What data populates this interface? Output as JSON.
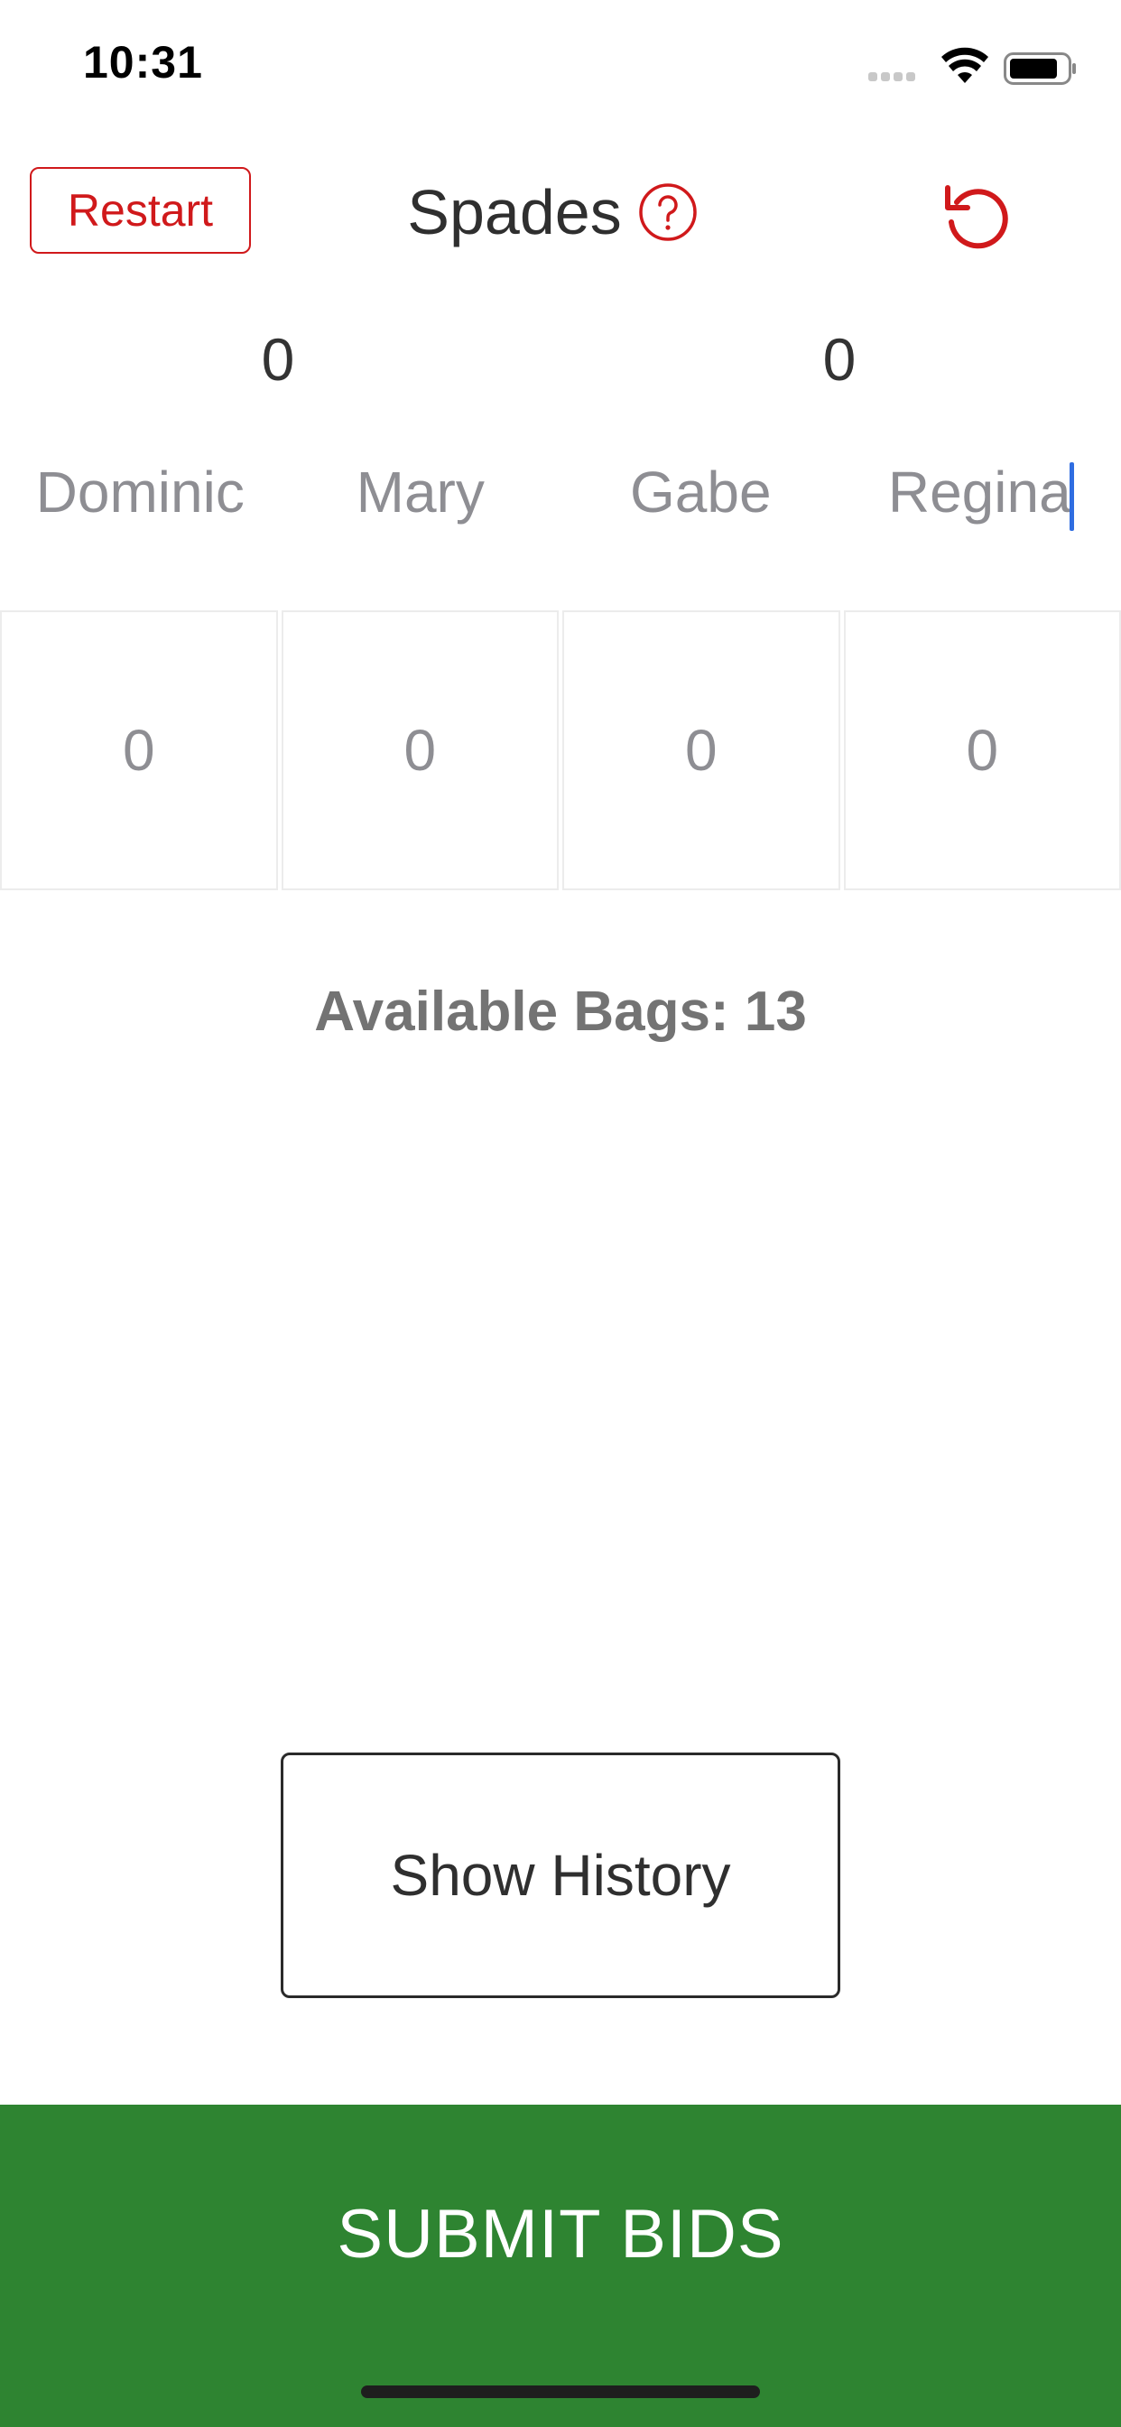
{
  "status_bar": {
    "time": "10:31",
    "icons": [
      "cellular-signal-icon",
      "wifi-icon",
      "battery-icon"
    ]
  },
  "header": {
    "restart_label": "Restart",
    "title": "Spades",
    "help_icon": "question-circle-icon",
    "undo_icon": "undo-icon"
  },
  "team_scores": [
    "0",
    "0"
  ],
  "players": [
    {
      "name": "Dominic",
      "bid": "0"
    },
    {
      "name": "Mary",
      "bid": "0"
    },
    {
      "name": "Gabe",
      "bid": "0"
    },
    {
      "name": "Regina",
      "bid": "0"
    }
  ],
  "available_bags": "Available Bags: 13",
  "history_button_label": "Show History",
  "submit_label": "SUBMIT BIDS",
  "colors": {
    "accent_red": "#d0191b",
    "submit_green": "#2e8431",
    "caret_blue": "#2f6de1",
    "muted_text": "#8e8e93"
  }
}
